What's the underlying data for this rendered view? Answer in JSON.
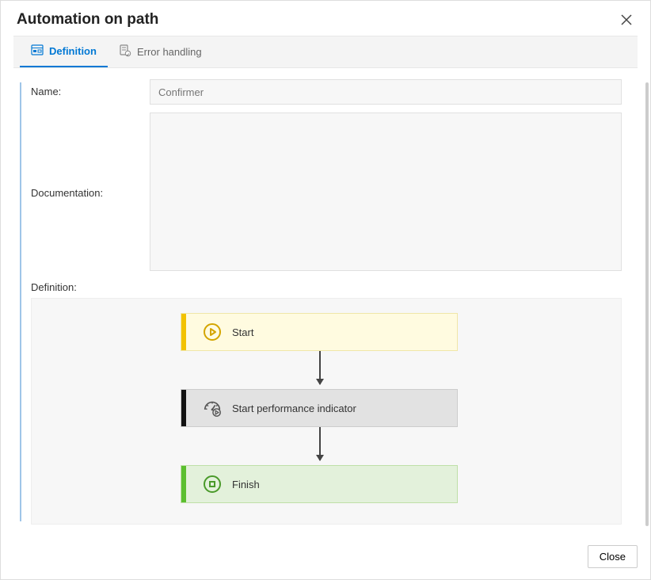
{
  "dialog": {
    "title": "Automation on path"
  },
  "tabs": {
    "definition": "Definition",
    "error_handling": "Error handling"
  },
  "form": {
    "name_label": "Name:",
    "name_placeholder": "Confirmer",
    "name_value": "",
    "doc_label": "Documentation:",
    "doc_value": "",
    "def_label": "Definition:"
  },
  "flow": {
    "start": "Start",
    "middle": "Start performance indicator",
    "finish": "Finish"
  },
  "footer": {
    "close": "Close"
  }
}
